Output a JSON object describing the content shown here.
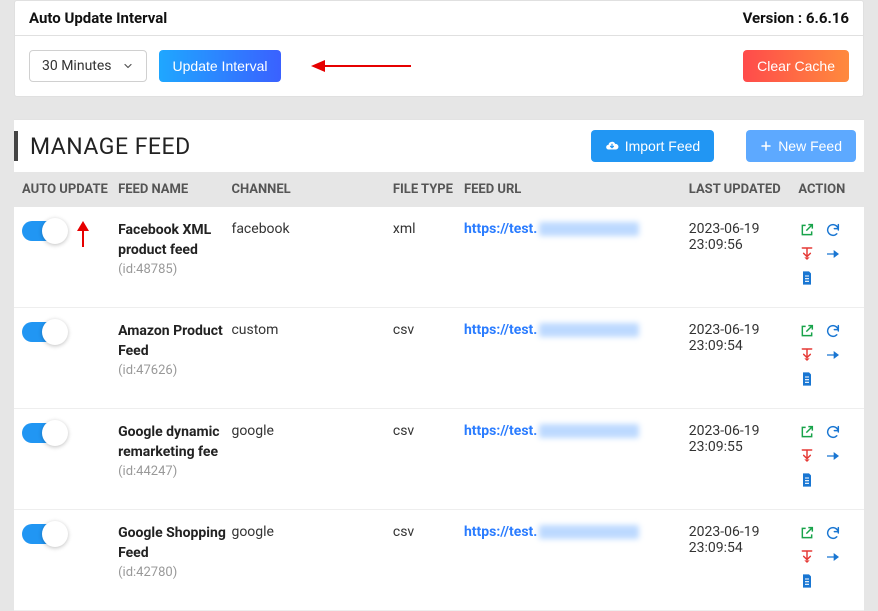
{
  "top_panel": {
    "title": "Auto Update Interval",
    "version_label": "Version :",
    "version": "6.6.16",
    "interval_selected": "30 Minutes",
    "update_btn": "Update Interval",
    "clear_cache_btn": "Clear Cache"
  },
  "section": {
    "title": "MANAGE FEED",
    "import_btn": "Import Feed",
    "new_btn": "New Feed"
  },
  "columns": {
    "auto": "AUTO UPDATE",
    "name": "FEED NAME",
    "channel": "CHANNEL",
    "type": "FILE TYPE",
    "url": "FEED URL",
    "updated": "LAST UPDATED",
    "action": "ACTION"
  },
  "rows": [
    {
      "name": "Facebook XML product feed",
      "id": "(id:48785)",
      "channel": "facebook",
      "type": "xml",
      "url": "https://test.",
      "updated_date": "2023-06-19",
      "updated_time": "23:09:56"
    },
    {
      "name": "Amazon Product Feed",
      "id": "(id:47626)",
      "channel": "custom",
      "type": "csv",
      "url": "https://test.",
      "updated_date": "2023-06-19",
      "updated_time": "23:09:54"
    },
    {
      "name": "Google dynamic remarketing fee",
      "id": "(id:44247)",
      "channel": "google",
      "type": "csv",
      "url": "https://test.",
      "updated_date": "2023-06-19",
      "updated_time": "23:09:55"
    },
    {
      "name": "Google Shopping Feed",
      "id": "(id:42780)",
      "channel": "google",
      "type": "csv",
      "url": "https://test.",
      "updated_date": "2023-06-19",
      "updated_time": "23:09:54"
    }
  ]
}
